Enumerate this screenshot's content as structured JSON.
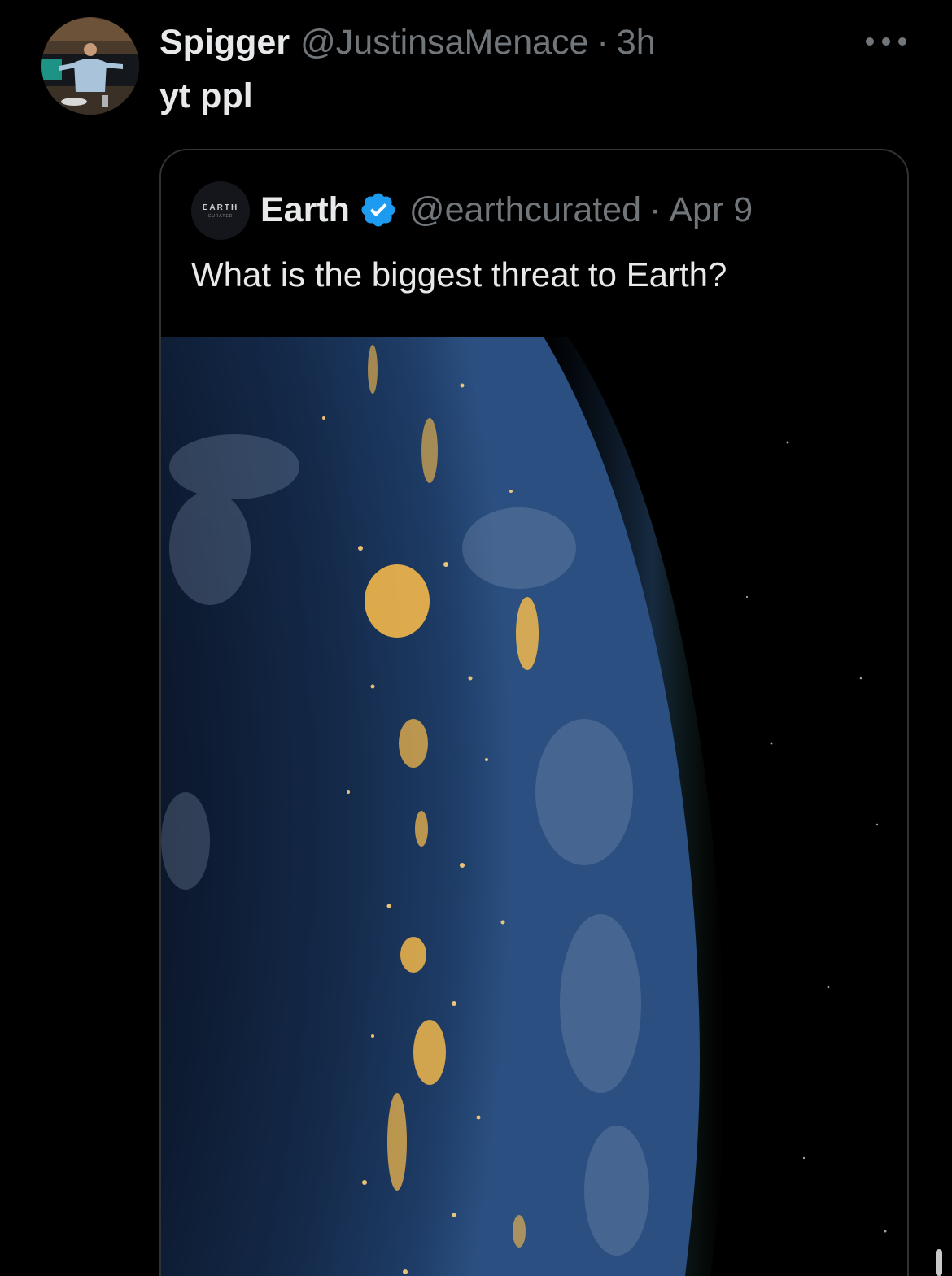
{
  "tweet": {
    "author_name": "Spigger",
    "author_handle": "@JustinsaMenace",
    "separator": "·",
    "time": "3h",
    "text": "yt ppl",
    "avatar_icon": "profile-photo",
    "more_icon": "more-options-icon"
  },
  "quoted_tweet": {
    "author_name": "Earth",
    "verified": true,
    "verified_color": "#1d9bf0",
    "author_handle": "@earthcurated",
    "separator": "·",
    "date": "Apr 9",
    "text": "What is the biggest threat to Earth?",
    "avatar_logo_text": "EARTH",
    "avatar_logo_subtext": "CURATED",
    "media_description_icon": "earth-at-night-image"
  },
  "colors": {
    "background": "#000000",
    "primary_text": "#e7e9ea",
    "secondary_text": "#71767b",
    "border": "#2f3336",
    "verified_badge": "#1d9bf0"
  }
}
